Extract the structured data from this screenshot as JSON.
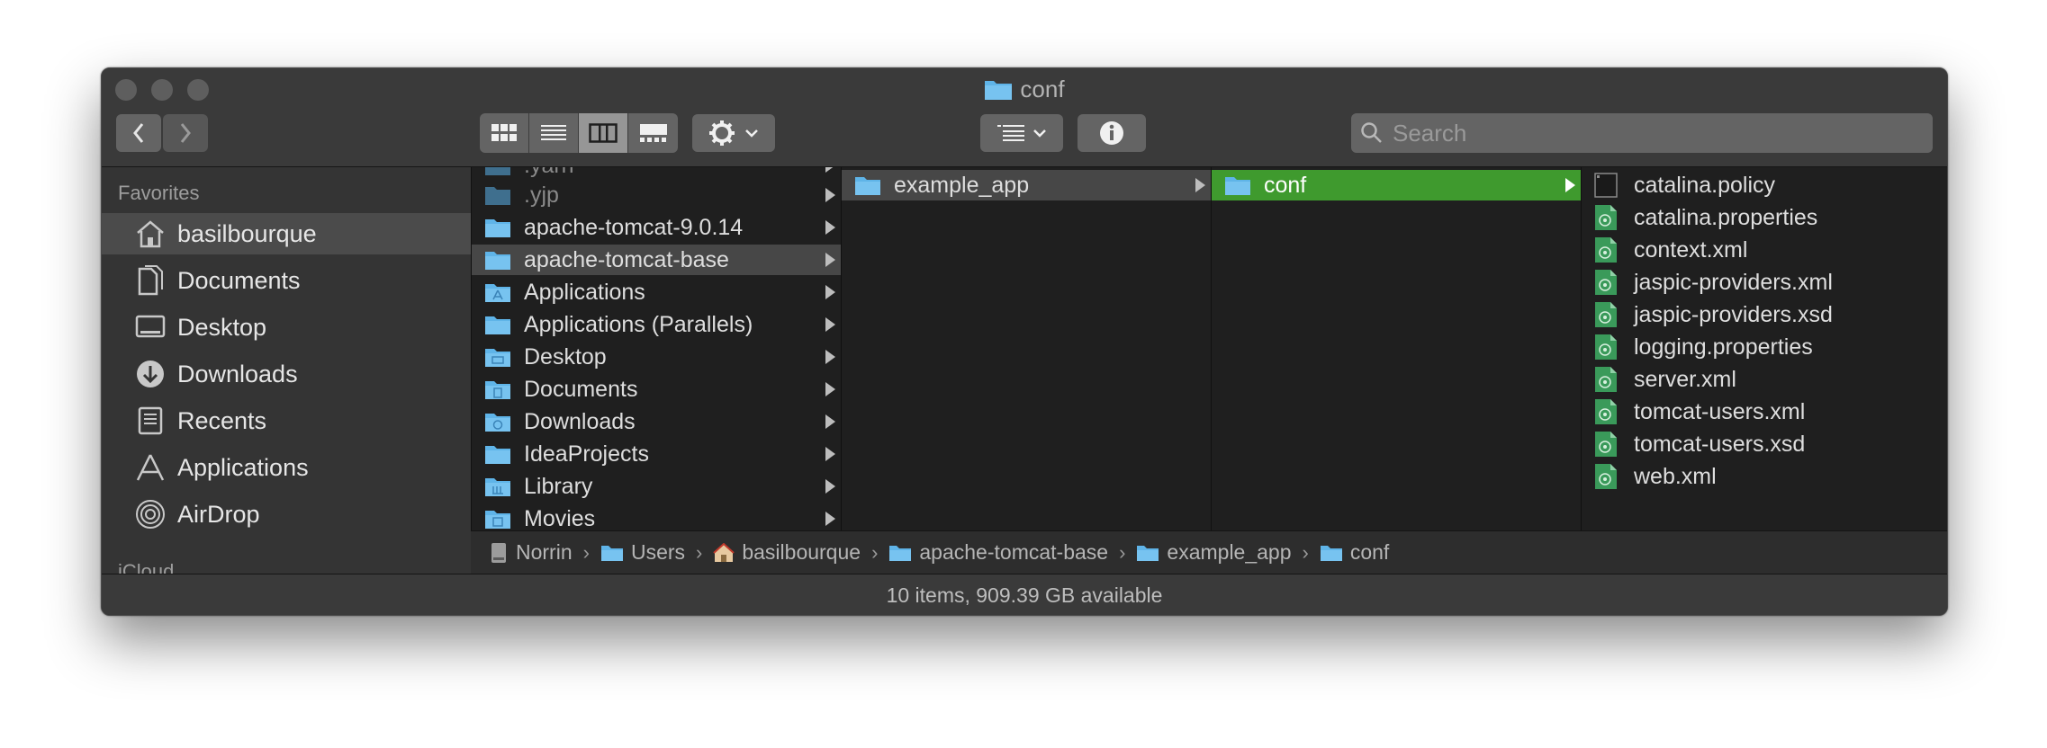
{
  "window": {
    "title": "conf"
  },
  "toolbar": {
    "back_icon": "chevron-left-icon",
    "forward_icon": "chevron-right-icon",
    "view_modes": [
      "icon-view",
      "list-view",
      "column-view",
      "gallery-view"
    ],
    "active_view": "column-view",
    "action_icon": "gear-icon",
    "group_icon": "group-by-icon",
    "info_icon": "info-icon",
    "search_placeholder": "Search"
  },
  "sidebar": {
    "favorites_header": "Favorites",
    "items": [
      {
        "label": "basilbourque",
        "icon": "home-icon",
        "selected": true
      },
      {
        "label": "Documents",
        "icon": "documents-icon"
      },
      {
        "label": "Desktop",
        "icon": "desktop-icon"
      },
      {
        "label": "Downloads",
        "icon": "downloads-icon"
      },
      {
        "label": "Recents",
        "icon": "recents-icon"
      },
      {
        "label": "Applications",
        "icon": "applications-icon"
      },
      {
        "label": "AirDrop",
        "icon": "airdrop-icon"
      }
    ],
    "icloud_header": "iCloud"
  },
  "columns": {
    "col1": [
      {
        "label": ".yarn",
        "dim": true
      },
      {
        "label": ".yjp",
        "dim": true
      },
      {
        "label": "apache-tomcat-9.0.14"
      },
      {
        "label": "apache-tomcat-base",
        "highlight": true
      },
      {
        "label": "Applications"
      },
      {
        "label": "Applications (Parallels)"
      },
      {
        "label": "Desktop"
      },
      {
        "label": "Documents"
      },
      {
        "label": "Downloads"
      },
      {
        "label": "IdeaProjects"
      },
      {
        "label": "Library"
      },
      {
        "label": "Movies"
      }
    ],
    "col2": [
      {
        "label": "example_app",
        "highlight": true
      }
    ],
    "col3": [
      {
        "label": "conf",
        "selected": true
      }
    ],
    "col4": [
      {
        "label": "catalina.policy",
        "icon": "text-file-icon"
      },
      {
        "label": "catalina.properties",
        "icon": "xml-file-icon"
      },
      {
        "label": "context.xml",
        "icon": "xml-file-icon"
      },
      {
        "label": "jaspic-providers.xml",
        "icon": "xml-file-icon"
      },
      {
        "label": "jaspic-providers.xsd",
        "icon": "xml-file-icon"
      },
      {
        "label": "logging.properties",
        "icon": "xml-file-icon"
      },
      {
        "label": "server.xml",
        "icon": "xml-file-icon"
      },
      {
        "label": "tomcat-users.xml",
        "icon": "xml-file-icon"
      },
      {
        "label": "tomcat-users.xsd",
        "icon": "xml-file-icon"
      },
      {
        "label": "web.xml",
        "icon": "xml-file-icon"
      }
    ]
  },
  "path_bar": [
    {
      "label": "Norrin",
      "icon": "hard-drive-icon"
    },
    {
      "label": "Users",
      "icon": "folder-icon"
    },
    {
      "label": "basilbourque",
      "icon": "home-icon"
    },
    {
      "label": "apache-tomcat-base",
      "icon": "folder-icon"
    },
    {
      "label": "example_app",
      "icon": "folder-icon"
    },
    {
      "label": "conf",
      "icon": "folder-icon"
    }
  ],
  "status_bar": "10 items, 909.39 GB available",
  "colors": {
    "selection_green": "#3f9a2e",
    "folder_blue": "#5fb4e8",
    "xml_icon_green": "#3a9a5a"
  }
}
